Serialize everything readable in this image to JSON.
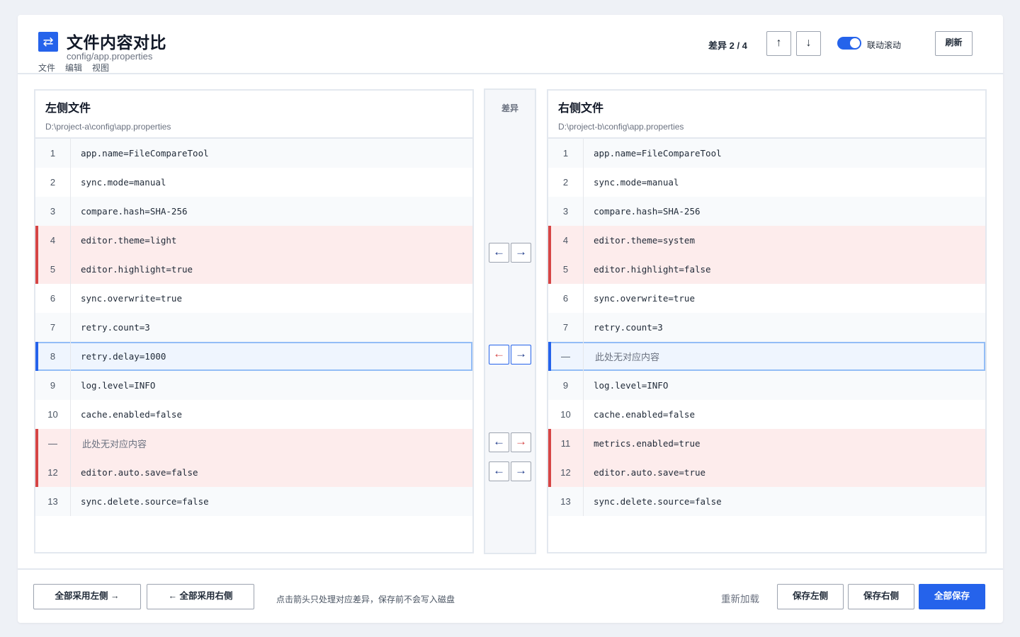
{
  "header": {
    "icon": "swap-icon",
    "icon_glyph": "⇄",
    "title": "文件内容对比",
    "subtitle": "config/app.properties",
    "menu": [
      "文件",
      "编辑",
      "视图"
    ],
    "diff_counter": "差异 2 / 4",
    "prev_glyph": "↑",
    "next_glyph": "↓",
    "sync_scroll_on": true,
    "sync_scroll_label": "联动滚动",
    "refresh_label": "刷新"
  },
  "left": {
    "title": "左侧文件",
    "path": "D:\\project-a\\config\\app.properties",
    "lines": [
      {
        "n": "1",
        "text": "app.name=FileCompareTool",
        "state": "alt"
      },
      {
        "n": "2",
        "text": "sync.mode=manual",
        "state": ""
      },
      {
        "n": "3",
        "text": "compare.hash=SHA-256",
        "state": "alt"
      },
      {
        "n": "4",
        "text": "editor.theme=light",
        "state": "diff"
      },
      {
        "n": "5",
        "text": "editor.highlight=true",
        "state": "diff"
      },
      {
        "n": "6",
        "text": "sync.overwrite=true",
        "state": ""
      },
      {
        "n": "7",
        "text": "retry.count=3",
        "state": "alt"
      },
      {
        "n": "8",
        "text": "retry.delay=1000",
        "state": "selected"
      },
      {
        "n": "9",
        "text": "log.level=INFO",
        "state": "alt"
      },
      {
        "n": "10",
        "text": "cache.enabled=false",
        "state": ""
      },
      {
        "n": "—",
        "text": "此处无对应内容",
        "state": "diff",
        "placeholder": true
      },
      {
        "n": "12",
        "text": "editor.auto.save=false",
        "state": "diff"
      },
      {
        "n": "13",
        "text": "sync.delete.source=false",
        "state": "alt"
      }
    ]
  },
  "right": {
    "title": "右侧文件",
    "path": "D:\\project-b\\config\\app.properties",
    "lines": [
      {
        "n": "1",
        "text": "app.name=FileCompareTool",
        "state": "alt"
      },
      {
        "n": "2",
        "text": "sync.mode=manual",
        "state": ""
      },
      {
        "n": "3",
        "text": "compare.hash=SHA-256",
        "state": "alt"
      },
      {
        "n": "4",
        "text": "editor.theme=system",
        "state": "diff"
      },
      {
        "n": "5",
        "text": "editor.highlight=false",
        "state": "diff"
      },
      {
        "n": "6",
        "text": "sync.overwrite=true",
        "state": ""
      },
      {
        "n": "7",
        "text": "retry.count=3",
        "state": "alt"
      },
      {
        "n": "—",
        "text": "此处无对应内容",
        "state": "selected",
        "placeholder": true
      },
      {
        "n": "9",
        "text": "log.level=INFO",
        "state": "alt"
      },
      {
        "n": "10",
        "text": "cache.enabled=false",
        "state": ""
      },
      {
        "n": "11",
        "text": "metrics.enabled=true",
        "state": "diff"
      },
      {
        "n": "12",
        "text": "editor.auto.save=true",
        "state": "diff"
      },
      {
        "n": "13",
        "text": "sync.delete.source=false",
        "state": "alt"
      }
    ]
  },
  "gutter": {
    "title": "差异",
    "left_glyph": "←",
    "right_glyph": "→",
    "colors": {
      "default": "#1e3a8a",
      "highlight": "#d64545",
      "accent": "#2563eb"
    }
  },
  "footer": {
    "accept_left_label": "全部采用左侧 →",
    "accept_right_label": "← 全部采用右侧",
    "hint": "点击箭头只处理对应差异，保存前不会写入磁盘",
    "reload_label": "重新加载",
    "save_left_label": "保存左侧",
    "save_right_label": "保存右侧",
    "save_all_label": "全部保存"
  }
}
